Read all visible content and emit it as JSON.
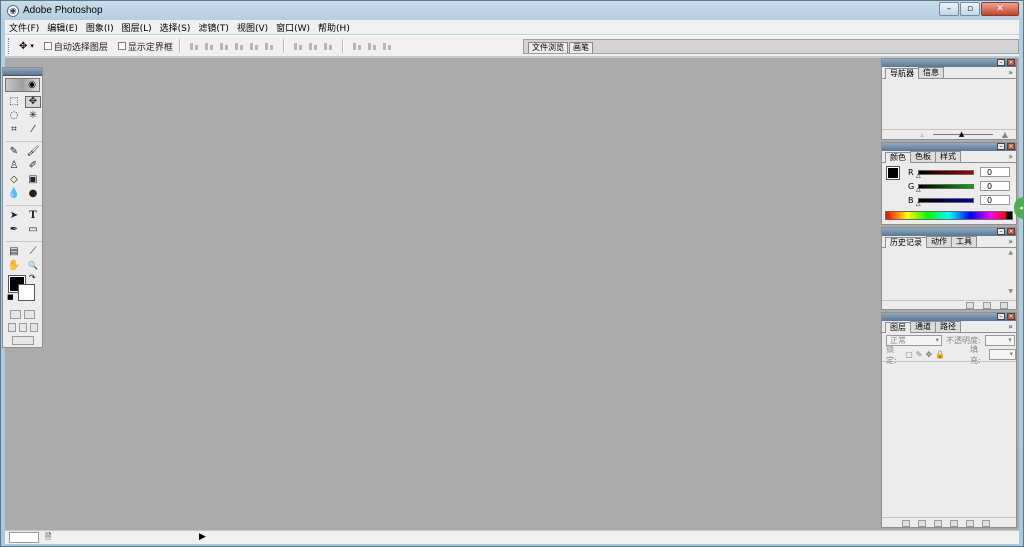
{
  "window": {
    "title": "Adobe Photoshop"
  },
  "menu": [
    "文件(F)",
    "编辑(E)",
    "图象(I)",
    "图层(L)",
    "选择(S)",
    "滤镜(T)",
    "视图(V)",
    "窗口(W)",
    "帮助(H)"
  ],
  "options": {
    "auto_select_layer": "自动选择图层",
    "show_bounding_box": "显示定界框"
  },
  "palette_well": {
    "tabs": [
      "文件浏览",
      "画笔"
    ]
  },
  "navigator_palette": {
    "tabs": [
      "导航器",
      "信息"
    ]
  },
  "color_palette": {
    "tabs": [
      "颜色",
      "色板",
      "样式"
    ],
    "channels": [
      {
        "label": "R",
        "value": "0",
        "color": "#b00000"
      },
      {
        "label": "G",
        "value": "0",
        "color": "#00a000"
      },
      {
        "label": "B",
        "value": "0",
        "color": "#0000b0"
      }
    ]
  },
  "history_palette": {
    "tabs": [
      "历史记录",
      "动作",
      "工具"
    ]
  },
  "layers_palette": {
    "tabs": [
      "图层",
      "通道",
      "路径"
    ],
    "blend_mode": "正常",
    "opacity_label": "不透明度:",
    "lock_label": "锁定:",
    "fill_label": "填充:"
  },
  "icons": {
    "move_tool": "✥",
    "marquee": "⬚",
    "lasso": "◌",
    "crop": "⌗",
    "text": "T",
    "hand": "✋",
    "zoom": "🔍"
  },
  "colors": {
    "accent": "#5a7694",
    "workspace": "#ababab"
  }
}
